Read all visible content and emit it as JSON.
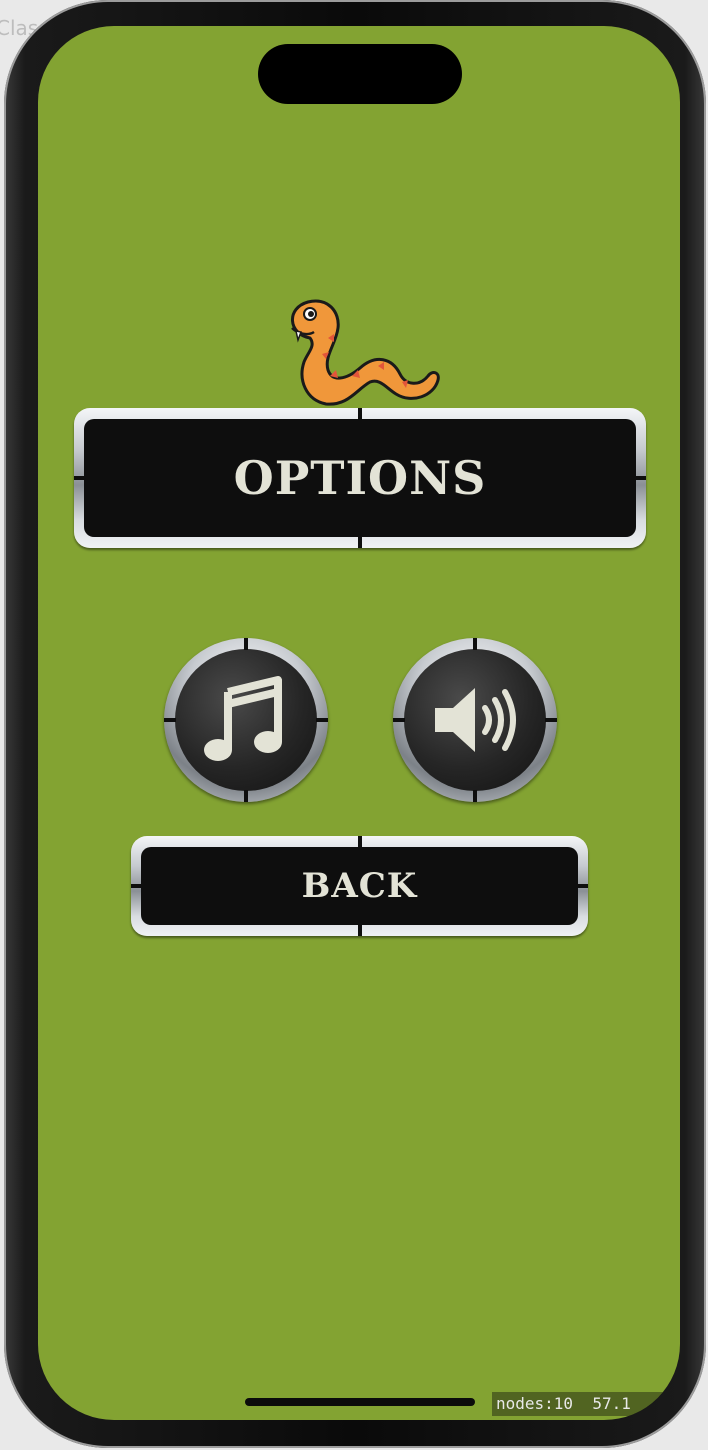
{
  "background_hint": "Class",
  "menu": {
    "title": "OPTIONS",
    "music_icon": "music-note-icon",
    "sound_icon": "speaker-icon",
    "back_label": "BACK"
  },
  "debug": {
    "nodes": "nodes:10",
    "fps": "57.1"
  },
  "colors": {
    "screen_background": "#83a332",
    "button_face": "#0e0e0e",
    "button_text": "#e3e3d6",
    "snake": "#f0973a"
  }
}
